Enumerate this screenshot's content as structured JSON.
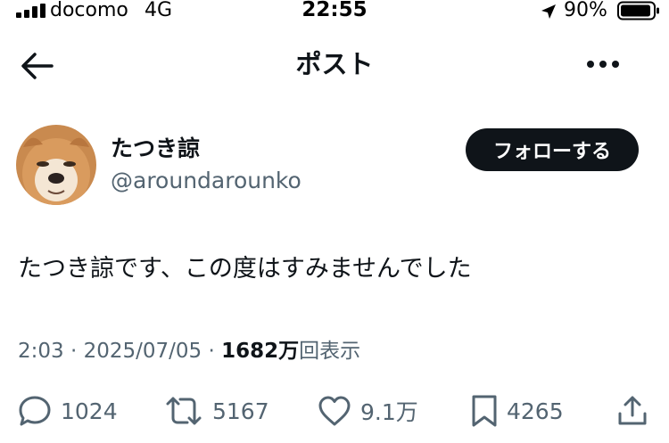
{
  "status_bar": {
    "carrier": "docomo",
    "network": "4G",
    "time": "22:55",
    "battery_pct": "90%"
  },
  "nav": {
    "title": "ポスト"
  },
  "author": {
    "name": "たつき諒",
    "handle": "@aroundarounko",
    "follow_label": "フォローする"
  },
  "post": {
    "text": "たつき諒です、この度はすみませんでした",
    "time": "2:03",
    "date": "2025/07/05",
    "views_count": "1682",
    "views_unit": "万",
    "views_suffix": "回表示",
    "separator": "·"
  },
  "actions": {
    "replies": "1024",
    "reposts": "5167",
    "likes": "9.1万",
    "bookmarks": "4265"
  },
  "colors": {
    "text": "#0f1419",
    "muted": "#536471",
    "follow_bg": "#0f1419"
  },
  "icons": [
    "signal-icon",
    "location-arrow-icon",
    "battery-icon",
    "back-arrow-icon",
    "more-icon",
    "reply-icon",
    "repost-icon",
    "like-icon",
    "bookmark-icon",
    "share-icon"
  ]
}
